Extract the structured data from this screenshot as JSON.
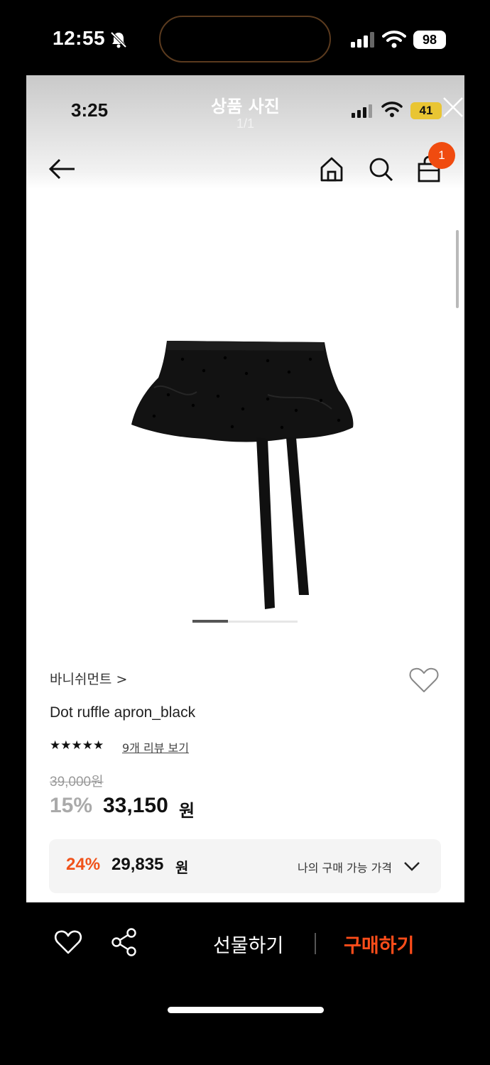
{
  "outer_status": {
    "time": "12:55",
    "battery": "98"
  },
  "viewer": {
    "inner_time": "3:25",
    "title": "상품 사진",
    "counter": "1/1",
    "inner_battery": "41"
  },
  "nav": {
    "cart_count": "1"
  },
  "product": {
    "brand": "바니쉬먼트 >",
    "name": "Dot ruffle apron_black",
    "stars": "★★★★★",
    "review_link": "9개 리뷰 보기",
    "original_price": "39,000원",
    "discount": "15%",
    "sale_price": "33,150",
    "sale_unit": "원"
  },
  "my_price": {
    "discount": "24%",
    "price": "29,835",
    "unit": "원",
    "label": "나의 구매 가능 가격"
  },
  "bottom_bar": {
    "gift_label": "선물하기",
    "buy_label": "구매하기"
  },
  "icons": [
    "bell-mute-icon",
    "signal-icon",
    "wifi-icon",
    "close-icon",
    "back-arrow-icon",
    "home-icon",
    "search-icon",
    "shopping-bag-icon",
    "heart-icon",
    "share-icon",
    "chevron-down-icon"
  ],
  "colors": {
    "accent": "#f04b0f",
    "buy": "#ff4d1a",
    "inner_battery": "#e9c533"
  }
}
